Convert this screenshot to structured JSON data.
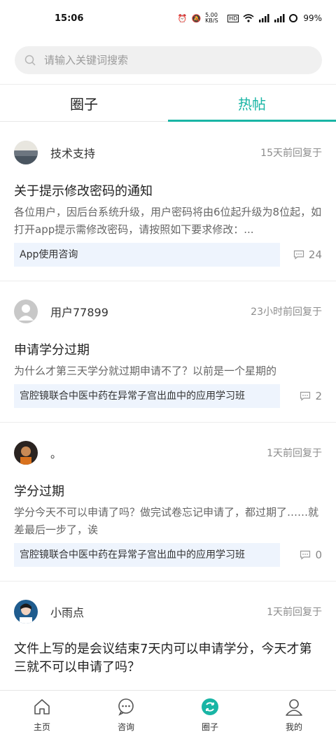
{
  "status": {
    "time": "15:06",
    "net_speed": "5.00 KB/S",
    "battery": "99%"
  },
  "search": {
    "placeholder": "请输入关键词搜索"
  },
  "tabs": [
    {
      "label": "圈子",
      "active": false
    },
    {
      "label": "热帖",
      "active": true
    }
  ],
  "posts": [
    {
      "user": "技术支持",
      "time": "15天前回复于",
      "title": "关于提示修改密码的通知",
      "excerpt": "各位用户，因后台系统升级，用户密码将由6位起升级为8位起，如打开app提示需修改密码，请按照如下要求修改：...",
      "tag": "App使用咨询",
      "comments": "24"
    },
    {
      "user": "用户77899",
      "time": "23小时前回复于",
      "title": "申请学分过期",
      "excerpt": "为什么才第三天学分就过期申请不了？以前是一个星期的",
      "tag": "宫腔镜联合中医中药在异常子宫出血中的应用学习班",
      "comments": "2"
    },
    {
      "user": "。",
      "time": "1天前回复于",
      "title": "学分过期",
      "excerpt": "学分今天不可以申请了吗？做完试卷忘记申请了，都过期了……就差最后一步了，诶",
      "tag": "宫腔镜联合中医中药在异常子宫出血中的应用学习班",
      "comments": "0"
    },
    {
      "user": "小雨点",
      "time": "1天前回复于",
      "title": "文件上写的是会议结束7天内可以申请学分，今天才第三就不可以申请了吗？",
      "excerpt": "",
      "tag": "",
      "comments": ""
    }
  ],
  "tabbar": [
    {
      "label": "主页",
      "icon": "home-icon",
      "active": false
    },
    {
      "label": "咨询",
      "icon": "chat-icon",
      "active": false
    },
    {
      "label": "圈子",
      "icon": "circle-icon",
      "active": true
    },
    {
      "label": "我的",
      "icon": "user-icon",
      "active": false
    }
  ],
  "colors": {
    "accent": "#19b5a5",
    "tag_bg": "#eef4fd"
  }
}
